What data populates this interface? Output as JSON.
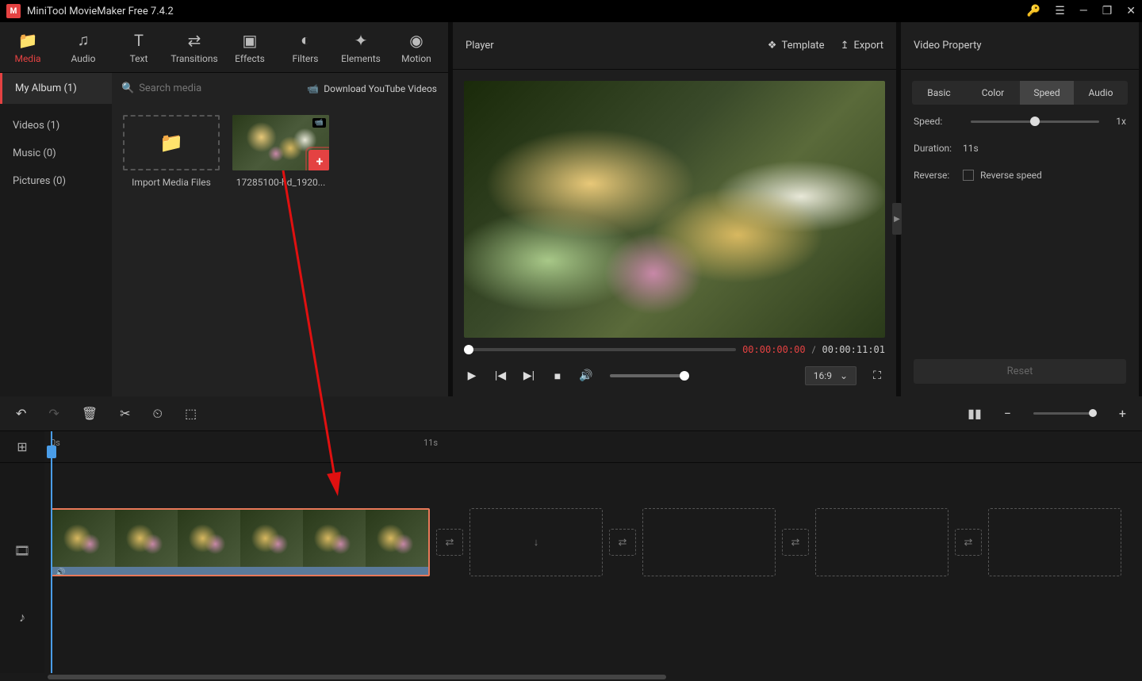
{
  "app": {
    "title": "MiniTool MovieMaker Free 7.4.2"
  },
  "topTabs": [
    {
      "label": "Media",
      "icon": "folder"
    },
    {
      "label": "Audio",
      "icon": "music"
    },
    {
      "label": "Text",
      "icon": "text"
    },
    {
      "label": "Transitions",
      "icon": "transition"
    },
    {
      "label": "Effects",
      "icon": "effects"
    },
    {
      "label": "Filters",
      "icon": "filters"
    },
    {
      "label": "Elements",
      "icon": "elements"
    },
    {
      "label": "Motion",
      "icon": "motion"
    }
  ],
  "library": {
    "albumLabel": "My Album (1)",
    "searchPlaceholder": "Search media",
    "downloadLabel": "Download YouTube Videos",
    "sidebar": [
      {
        "label": "Videos (1)"
      },
      {
        "label": "Music (0)"
      },
      {
        "label": "Pictures (0)"
      }
    ],
    "importLabel": "Import Media Files",
    "mediaItem": {
      "label": "17285100-hd_1920..."
    }
  },
  "player": {
    "title": "Player",
    "templateLabel": "Template",
    "exportLabel": "Export",
    "currentTime": "00:00:00:00",
    "totalTime": "00:00:11:01",
    "aspectRatio": "16:9"
  },
  "property": {
    "title": "Video Property",
    "tabs": [
      "Basic",
      "Color",
      "Speed",
      "Audio"
    ],
    "speedLabel": "Speed:",
    "speedValue": "1x",
    "durationLabel": "Duration:",
    "durationValue": "11s",
    "reverseLabel": "Reverse:",
    "reverseCheckLabel": "Reverse speed",
    "resetLabel": "Reset"
  },
  "timeline": {
    "rulerMarks": [
      {
        "label": "0s",
        "pos": 8
      },
      {
        "label": "11s",
        "pos": 478
      }
    ]
  }
}
